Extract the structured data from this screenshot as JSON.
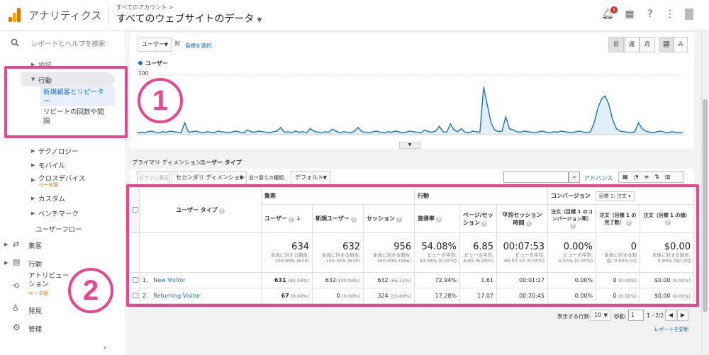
{
  "header": {
    "app_title": "アナリティクス",
    "account_label": "すべてのアカウント >",
    "property_title": "すべてのウェブサイトのデータ",
    "notification_count": "1"
  },
  "sidebar": {
    "search_label": "レポートとヘルプを検索",
    "items": {
      "region": "地域",
      "behavior": "行動",
      "new_vs_returning": "新規顧客とリピーター",
      "frequency": "リピートの回数や間隔",
      "technology": "テクノロジー",
      "mobile": "モバイル",
      "cross_device": "クロスデバイス",
      "cross_device_badge": "ベータ版",
      "custom": "カスタム",
      "benchmark": "ベンチマーク",
      "user_flow": "ユーザーフロー",
      "acquisition": "集客",
      "behavior_top": "行動",
      "attribution": "アトリビューション",
      "attribution_badge": "ベータ版",
      "discover": "発見",
      "admin": "管理"
    }
  },
  "annotations": {
    "one": "1",
    "two": "2"
  },
  "controls": {
    "metric_select": "ユーザー",
    "vs_label": "対",
    "select_metric_link": "指標を選択",
    "day": "日",
    "week": "週",
    "month": "月",
    "legend_label": "ユーザー",
    "y_axis_top": "100",
    "primary_dimension_label": "プライマリ ディメンション:",
    "primary_dimension_value": "ユーザー タイプ",
    "plot_rows_button": "グラフに表示",
    "secondary_dimension": "セカンダリ ディメンション",
    "sort_type_label": "並べ替えの種類:",
    "sort_type_value": "デフォルト",
    "advanced_link": "アドバンス",
    "rows_label": "表示する行数:",
    "rows_value": "10",
    "goto_label": "移動:",
    "goto_value": "1",
    "page_range": "1 - 2/2",
    "refresh_link": "· レポートを更新"
  },
  "chart_data": {
    "type": "line",
    "series": [
      {
        "name": "ユーザー",
        "values": [
          3,
          4,
          3,
          5,
          6,
          4,
          3,
          5,
          4,
          6,
          5,
          4,
          3,
          20,
          4,
          5,
          6,
          4,
          3,
          5,
          4,
          3,
          6,
          5,
          4,
          3,
          5,
          6,
          4,
          3,
          8,
          5,
          4,
          6,
          5,
          4,
          3,
          5,
          6,
          12,
          4,
          5,
          3,
          6,
          4,
          5,
          3,
          10,
          6,
          4,
          3,
          5,
          4,
          9,
          6,
          3,
          5,
          4,
          3,
          6,
          12,
          5,
          4,
          3,
          5,
          6,
          4,
          3,
          5,
          4,
          6,
          5,
          3,
          4,
          6,
          5,
          4,
          3,
          8,
          5,
          4,
          6,
          14,
          5,
          4,
          18,
          8,
          5,
          10,
          4,
          3,
          6,
          5,
          4,
          80,
          50,
          20,
          8,
          5,
          6,
          30,
          10,
          8,
          5,
          4,
          6,
          5,
          4,
          3,
          5,
          6,
          4,
          3,
          5,
          4,
          6,
          5,
          4,
          3,
          5,
          6,
          4,
          3,
          5,
          20,
          45,
          60,
          65,
          50,
          25,
          10,
          6,
          5,
          4,
          3,
          5,
          20,
          10,
          6,
          4,
          3,
          5,
          6,
          4,
          3,
          5,
          4,
          3,
          4
        ]
      }
    ],
    "ylim": [
      0,
      100
    ],
    "grid": false
  },
  "table": {
    "group_acquisition": "集客",
    "group_behavior": "行動",
    "group_conversion": "コンバージョン",
    "goal_select": "目標 1: 注文",
    "dimension_header": "ユーザー タイプ",
    "columns": [
      "ユーザー",
      "新規ユーザー",
      "セッション",
      "直帰率",
      "ページ/セッション",
      "平均セッション時間",
      "注文（目標 1 のコンバージョン率）",
      "注文（目標 1 の完了数）",
      "注文（目標 1 の値）"
    ],
    "totals": {
      "users": "634",
      "users_sub": "全体に対する割合: 100.00% (634)",
      "new_users": "632",
      "new_users_sub": "全体に対する割合: 100.32% (630)",
      "sessions": "956",
      "sessions_sub": "全体に対する割合: 100.00% (956)",
      "bounce": "54.08%",
      "bounce_sub": "ビューの平均: 54.08% (0.00%)",
      "pps": "6.85",
      "pps_sub": "ビューの平均: 6.85 (0.00%)",
      "duration": "00:07:53",
      "duration_sub": "ビューの平均: 00:07:53 (0.00%)",
      "conv_rate": "0.00%",
      "conv_rate_sub": "ビューの平均: 0.00% (0.00%)",
      "completions": "0",
      "completions_sub": "全体に対する割合: 0.00% (0)",
      "value": "$0.00",
      "value_sub": "全体に対する割合: 0.00% ($0.00)"
    },
    "rows": [
      {
        "idx": "1.",
        "name": "New Visitor",
        "users": "631",
        "users_pct": "(90.40%)",
        "new_users": "632",
        "new_users_pct": "(100.00%)",
        "sessions": "632",
        "sessions_pct": "(66.11%)",
        "bounce": "72.94%",
        "pps": "1.61",
        "duration": "00:01:17",
        "conv_rate": "0.00%",
        "completions": "0",
        "completions_pct": "(0.00%)",
        "value": "$0.00",
        "value_pct": "(0.00%)"
      },
      {
        "idx": "2.",
        "name": "Returning Visitor",
        "users": "67",
        "users_pct": "(9.60%)",
        "new_users": "0",
        "new_users_pct": "(0.00%)",
        "sessions": "324",
        "sessions_pct": "(33.89%)",
        "bounce": "17.28%",
        "pps": "17.07",
        "duration": "00:20:45",
        "conv_rate": "0.00%",
        "completions": "0",
        "completions_pct": "(0.00%)",
        "value": "$0.00",
        "value_pct": "(0.00%)"
      }
    ]
  }
}
